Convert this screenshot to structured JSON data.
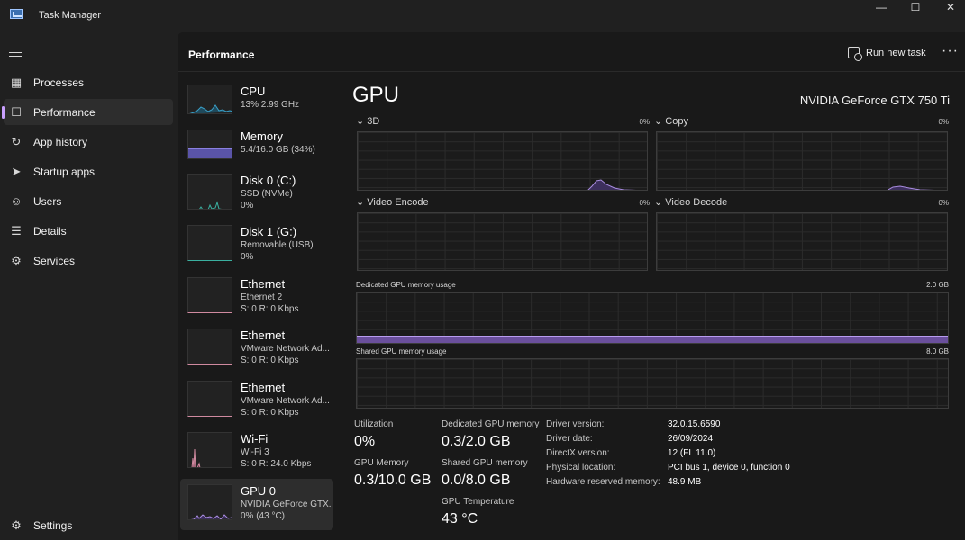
{
  "window": {
    "title": "Task Manager"
  },
  "sidebar": {
    "items": [
      {
        "label": "Processes",
        "icon": "processes-icon"
      },
      {
        "label": "Performance",
        "icon": "performance-icon",
        "active": true
      },
      {
        "label": "App history",
        "icon": "app-history-icon"
      },
      {
        "label": "Startup apps",
        "icon": "startup-apps-icon"
      },
      {
        "label": "Users",
        "icon": "users-icon"
      },
      {
        "label": "Details",
        "icon": "details-icon"
      },
      {
        "label": "Services",
        "icon": "services-icon"
      }
    ],
    "settings_label": "Settings"
  },
  "header": {
    "title": "Performance",
    "run_new_task": "Run new task"
  },
  "devices": [
    {
      "name": "CPU",
      "sub": "13% 2.99 GHz",
      "val": "",
      "color": "#3aa0c8"
    },
    {
      "name": "Memory",
      "sub": "5.4/16.0 GB (34%)",
      "val": "",
      "color": "#7a6bd0"
    },
    {
      "name": "Disk 0 (C:)",
      "sub": "SSD (NVMe)",
      "val": "0%",
      "color": "#3ab0a0"
    },
    {
      "name": "Disk 1 (G:)",
      "sub": "Removable (USB)",
      "val": "0%",
      "color": "#3ab0a0"
    },
    {
      "name": "Ethernet",
      "sub": "Ethernet 2",
      "val": "S: 0 R: 0 Kbps",
      "color": "#d08aa0"
    },
    {
      "name": "Ethernet",
      "sub": "VMware Network Ad...",
      "val": "S: 0 R: 0 Kbps",
      "color": "#d08aa0"
    },
    {
      "name": "Ethernet",
      "sub": "VMware Network Ad...",
      "val": "S: 0 R: 0 Kbps",
      "color": "#d08aa0"
    },
    {
      "name": "Wi-Fi",
      "sub": "Wi-Fi 3",
      "val": "S: 0 R: 24.0 Kbps",
      "color": "#d08aa0"
    },
    {
      "name": "GPU 0",
      "sub": "NVIDIA GeForce GTX...",
      "val": "0% (43 °C)",
      "color": "#a98ce0",
      "active": true
    }
  ],
  "gpu": {
    "title": "GPU",
    "model": "NVIDIA GeForce GTX 750 Ti",
    "engines": [
      {
        "label": "3D",
        "pct": "0%"
      },
      {
        "label": "Copy",
        "pct": "0%"
      },
      {
        "label": "Video Encode",
        "pct": "0%"
      },
      {
        "label": "Video Decode",
        "pct": "0%"
      }
    ],
    "dedicated_label": "Dedicated GPU memory usage",
    "dedicated_max": "2.0 GB",
    "dedicated_fraction": 0.15,
    "shared_label": "Shared GPU memory usage",
    "shared_max": "8.0 GB",
    "accent_color": "#a98ce0",
    "stats": [
      {
        "label": "Utilization",
        "value": "0%"
      },
      {
        "label": "GPU Memory",
        "value": "0.3/10.0 GB"
      },
      {
        "label": "Dedicated GPU memory",
        "value": "0.3/2.0 GB"
      },
      {
        "label": "Shared GPU memory",
        "value": "0.0/8.0 GB"
      },
      {
        "label": "GPU Temperature",
        "value": "43 °C"
      }
    ],
    "info": [
      {
        "key": "Driver version:",
        "val": "32.0.15.6590"
      },
      {
        "key": "Driver date:",
        "val": "26/09/2024"
      },
      {
        "key": "DirectX version:",
        "val": "12 (FL 11.0)"
      },
      {
        "key": "Physical location:",
        "val": "PCI bus 1, device 0, function 0"
      },
      {
        "key": "Hardware reserved memory:",
        "val": "48.9 MB"
      }
    ]
  }
}
